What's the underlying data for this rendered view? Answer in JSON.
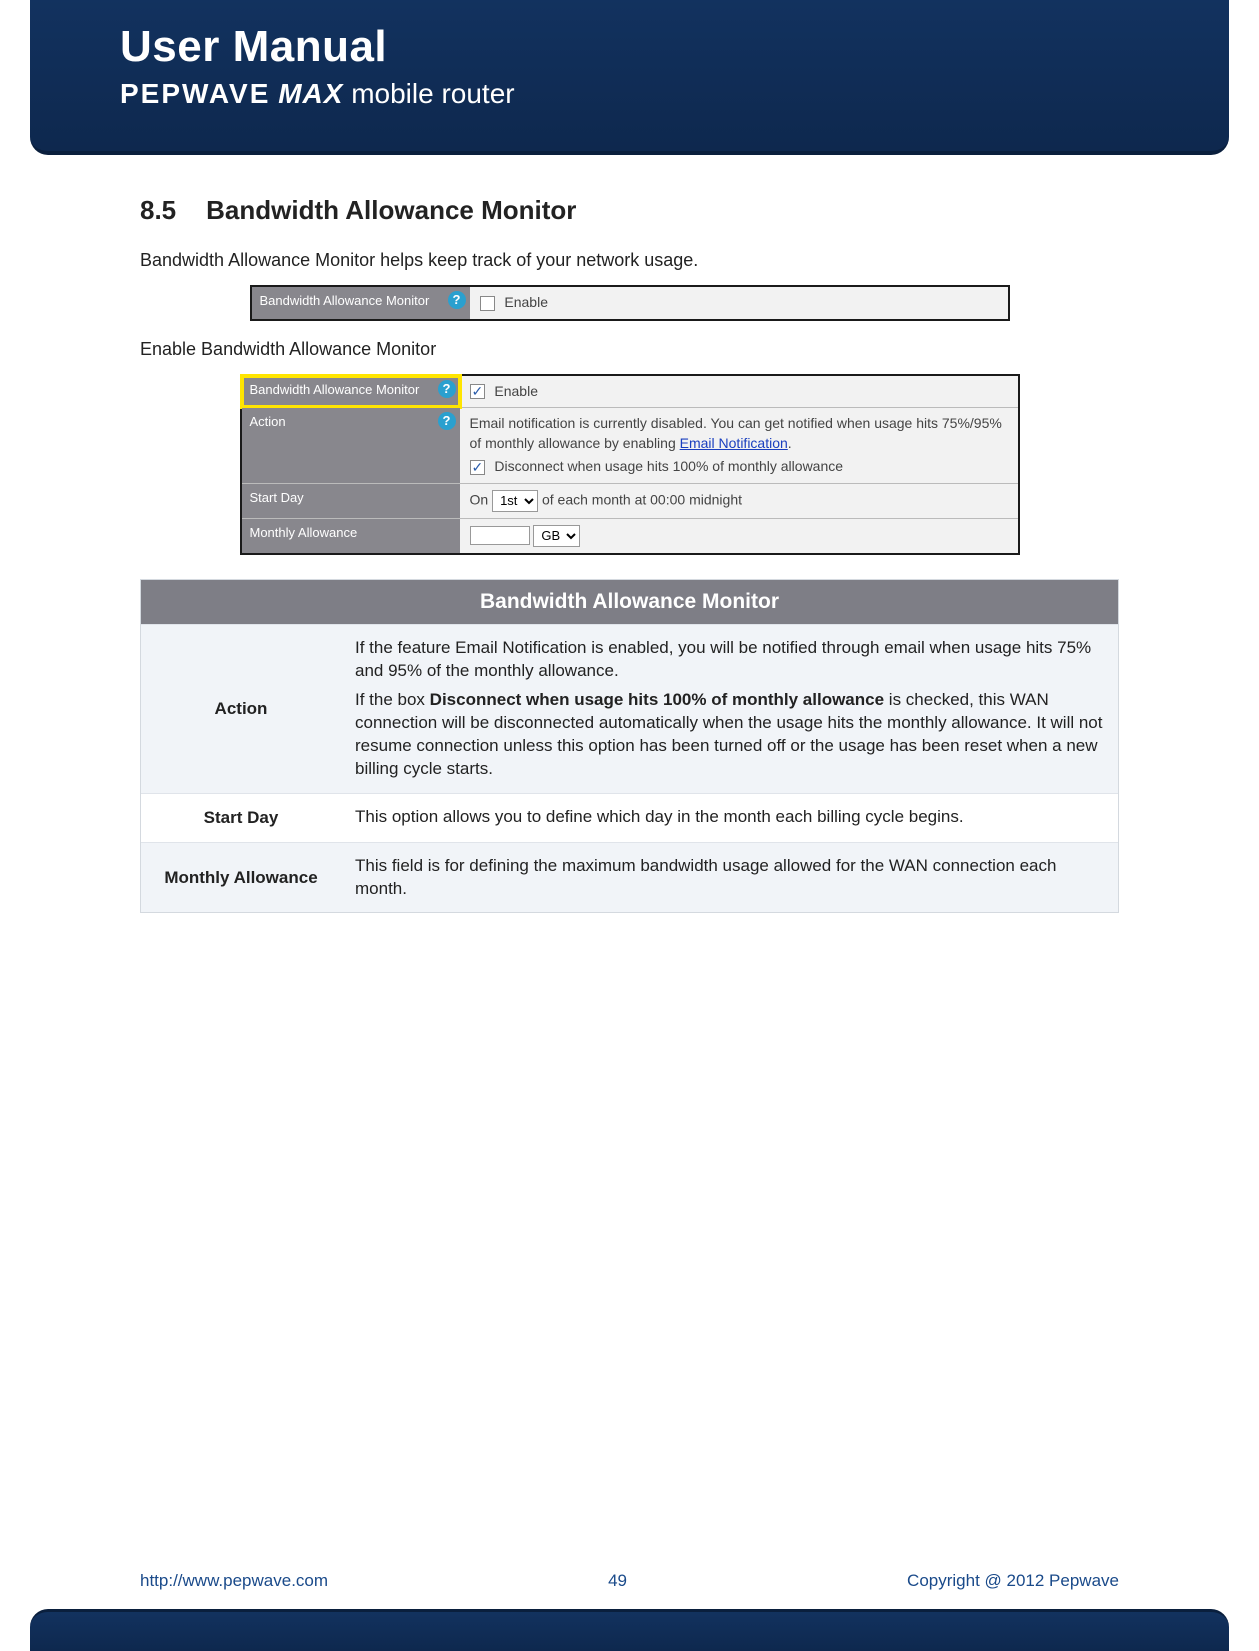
{
  "header": {
    "title": "User Manual",
    "brand": "PEPWAVE",
    "product": "MAX",
    "suffix": "mobile router"
  },
  "section": {
    "number": "8.5",
    "title": "Bandwidth Allowance Monitor",
    "intro": "Bandwidth Allowance Monitor helps keep track of your network usage.",
    "enable_caption": "Enable Bandwidth Allowance Monitor"
  },
  "panel1": {
    "label": "Bandwidth Allowance Monitor",
    "enable_label": "Enable",
    "enable_checked": false
  },
  "panel2": {
    "rows": {
      "bam": {
        "label": "Bandwidth Allowance Monitor",
        "enable_label": "Enable",
        "enable_checked": true
      },
      "action": {
        "label": "Action",
        "text_pre": "Email notification is currently disabled. You can get notified when usage hits 75%/95% of monthly allowance by enabling ",
        "link": "Email Notification",
        "text_post": ".",
        "disconnect_label": "Disconnect when usage hits 100% of monthly allowance",
        "disconnect_checked": true
      },
      "start_day": {
        "label": "Start Day",
        "prefix": "On",
        "value": "1st",
        "suffix": "of each month at 00:00 midnight"
      },
      "monthly": {
        "label": "Monthly Allowance",
        "value": "",
        "unit": "GB"
      }
    }
  },
  "ref_table": {
    "title": "Bandwidth Allowance Monitor",
    "rows": [
      {
        "label": "Action",
        "p1": "If the feature Email Notification is enabled, you will be notified through email when usage hits 75% and 95% of the monthly allowance.",
        "p2_pre": "If the box ",
        "p2_bold": "Disconnect when usage hits 100% of monthly allowance",
        "p2_post": " is checked, this WAN connection will be disconnected automatically when the usage hits the monthly allowance. It will not resume connection unless this option has been turned off or the usage has been reset when a new billing cycle starts."
      },
      {
        "label": "Start Day",
        "p1": "This option allows you to define which day in the month each billing cycle begins."
      },
      {
        "label": "Monthly Allowance",
        "p1": "This field is for defining the maximum bandwidth usage allowed for the WAN connection each month."
      }
    ]
  },
  "footer": {
    "url": "http://www.pepwave.com",
    "page": "49",
    "copyright": "Copyright @ 2012 Pepwave"
  }
}
